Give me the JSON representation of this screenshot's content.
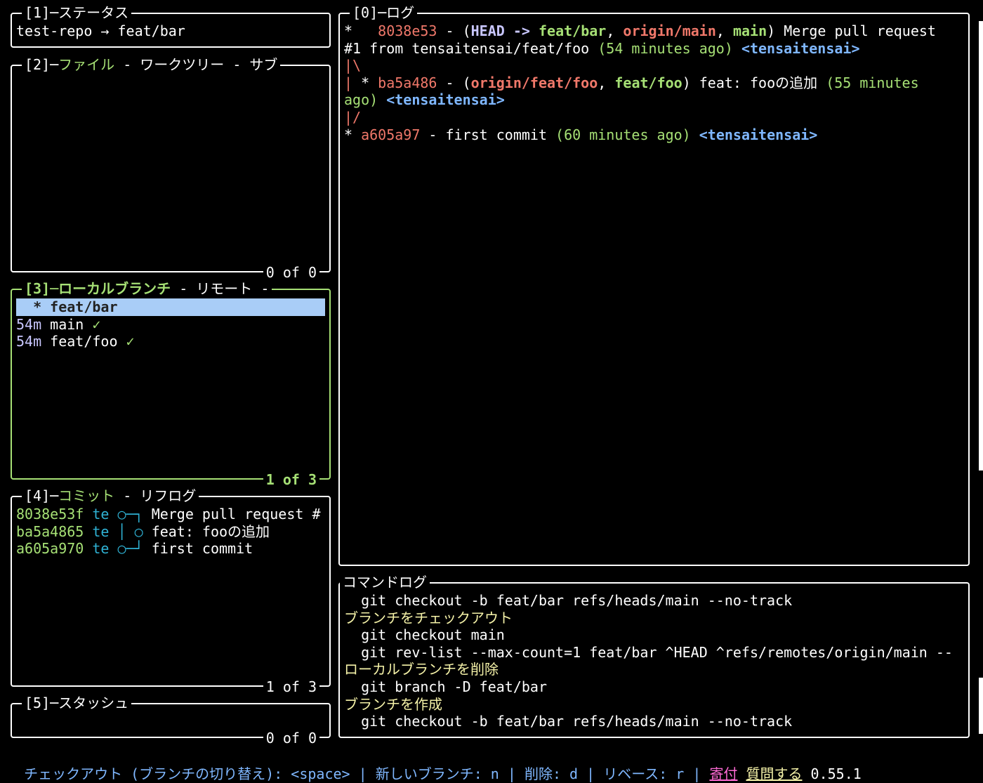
{
  "status": {
    "title": "[1]─ステータス",
    "repo_line": "test-repo → feat/bar"
  },
  "files": {
    "title_prefix": "[2]─",
    "title_active": "ファイル",
    "title_rest": " - ワークツリー - サブ",
    "footer": "0 of 0"
  },
  "branches": {
    "title_active": "[3]─ローカルブランチ",
    "title_rest": " - リモート - ",
    "footer": "1 of 3",
    "items": [
      {
        "age": "",
        "marker": "  * ",
        "name": "feat/bar",
        "check": "",
        "selected": true
      },
      {
        "age": "54m",
        "marker": " ",
        "name": "main",
        "check": " ✓",
        "selected": false
      },
      {
        "age": "54m",
        "marker": " ",
        "name": "feat/foo",
        "check": " ✓",
        "selected": false
      }
    ]
  },
  "commits": {
    "title_prefix": "[4]─",
    "title_active": "コミット",
    "title_rest": " - リフログ",
    "footer": "1 of 3",
    "items": [
      {
        "hash": "8038e53f",
        "author": "te",
        "graph": "○─┐",
        "msg": "Merge pull request #"
      },
      {
        "hash": "ba5a4865",
        "author": "te",
        "graph": "│ ○",
        "msg": "feat: fooの追加"
      },
      {
        "hash": "a605a970",
        "author": "te",
        "graph": "○─┘",
        "msg": "first commit"
      }
    ]
  },
  "stash": {
    "title": "[5]─スタッシュ",
    "footer": "0 of 0"
  },
  "log": {
    "title": "[0]─ログ",
    "l1": {
      "star": "*   ",
      "hash": "8038e53",
      "sep": " - (",
      "head": "HEAD ->",
      "sp": " ",
      "b1": "feat/bar",
      "c1": ", ",
      "b2": "origin/main",
      "c2": ", ",
      "b3": "main",
      "end": ") Merge pull request"
    },
    "l2": {
      "text": "#1 from tensaitensai/feat/foo ",
      "time": "(54 minutes ago)",
      "sp": " ",
      "author": "<tensaitensai>"
    },
    "l3": {
      "graph": "|\\"
    },
    "l4": {
      "graph": "|",
      "star": " * ",
      "hash": "ba5a486",
      "sep": " - (",
      "b1": "origin/feat/foo",
      "c1": ", ",
      "b2": "feat/foo",
      "end": ") feat: fooの追加 ",
      "time": "(55 minutes"
    },
    "l5": {
      "time": "ago)",
      "sp": " ",
      "author": "<tensaitensai>"
    },
    "l6": {
      "graph": "|/"
    },
    "l7": {
      "star": "* ",
      "hash": "a605a97",
      "text": " - first commit ",
      "time": "(60 minutes ago)",
      "sp": " ",
      "author": "<tensaitensai>"
    }
  },
  "cmdlog": {
    "title": "コマンドログ",
    "lines": [
      {
        "kind": "cmd",
        "text": "  git checkout -b feat/bar refs/heads/main --no-track"
      },
      {
        "kind": "desc",
        "text": "ブランチをチェックアウト"
      },
      {
        "kind": "cmd",
        "text": "  git checkout main"
      },
      {
        "kind": "cmd",
        "text": "  git rev-list --max-count=1 feat/bar ^HEAD ^refs/remotes/origin/main --"
      },
      {
        "kind": "desc",
        "text": "ローカルブランチを削除"
      },
      {
        "kind": "cmd",
        "text": "  git branch -D feat/bar"
      },
      {
        "kind": "desc",
        "text": "ブランチを作成"
      },
      {
        "kind": "cmd",
        "text": "  git checkout -b feat/bar refs/heads/main --no-track"
      }
    ]
  },
  "statusbar": {
    "hints": "チェックアウト (ブランチの切り替え): <space> | 新しいブランチ: n | 削除: d | リベース: r | ",
    "donate": "寄付",
    "ask": "質問する",
    "version": "0.55.1"
  },
  "colors": {
    "active_border": "#a6e075",
    "selection_bg": "#a9cdf7",
    "hash_red": "#f0786a",
    "author_blue": "#7fb7ff",
    "time_green": "#a6e075",
    "hint_blue": "#7fb7ff"
  }
}
